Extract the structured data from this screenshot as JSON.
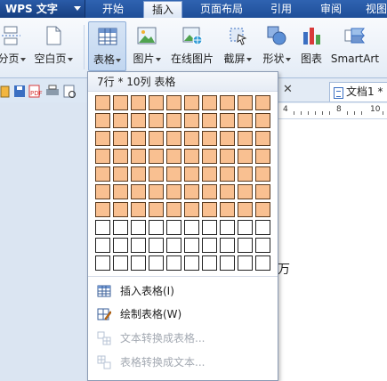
{
  "app": {
    "title": "WPS 文字"
  },
  "menu": {
    "tabs": [
      {
        "label": "开始"
      },
      {
        "label": "插入",
        "active": true
      },
      {
        "label": "页面布局"
      },
      {
        "label": "引用"
      },
      {
        "label": "审阅"
      },
      {
        "label": "视图"
      }
    ]
  },
  "ribbon": {
    "buttons": [
      {
        "label": "分页",
        "icon": "page-break-icon"
      },
      {
        "label": "空白页",
        "icon": "blank-page-icon"
      },
      {
        "label": "表格",
        "icon": "table-icon",
        "pressed": true
      },
      {
        "label": "图片",
        "icon": "picture-icon"
      },
      {
        "label": "在线图片",
        "icon": "online-picture-icon"
      },
      {
        "label": "截屏",
        "icon": "screenshot-icon"
      },
      {
        "label": "形状",
        "icon": "shapes-icon"
      },
      {
        "label": "图表",
        "icon": "chart-icon"
      },
      {
        "label": "SmartArt",
        "icon": "smartart-icon"
      }
    ]
  },
  "document": {
    "tab_label": "文档1 *",
    "ruler_numbers": [
      "4",
      "8",
      "10"
    ],
    "page_text": "万"
  },
  "table_dropdown": {
    "title": "7行 * 10列 表格",
    "grid": {
      "rows": 10,
      "cols": 10,
      "selected_rows": 7,
      "selected_cols": 10
    },
    "colors": {
      "selected_fill": "#f9c091",
      "cell_border": "#222222"
    },
    "items": [
      {
        "label": "插入表格(I)",
        "icon": "insert-table-icon",
        "disabled": false
      },
      {
        "label": "绘制表格(W)",
        "icon": "draw-table-icon",
        "disabled": false
      },
      {
        "label": "文本转换成表格...",
        "icon": "text-to-table-icon",
        "disabled": true
      },
      {
        "label": "表格转换成文本...",
        "icon": "table-to-text-icon",
        "disabled": true
      }
    ]
  }
}
